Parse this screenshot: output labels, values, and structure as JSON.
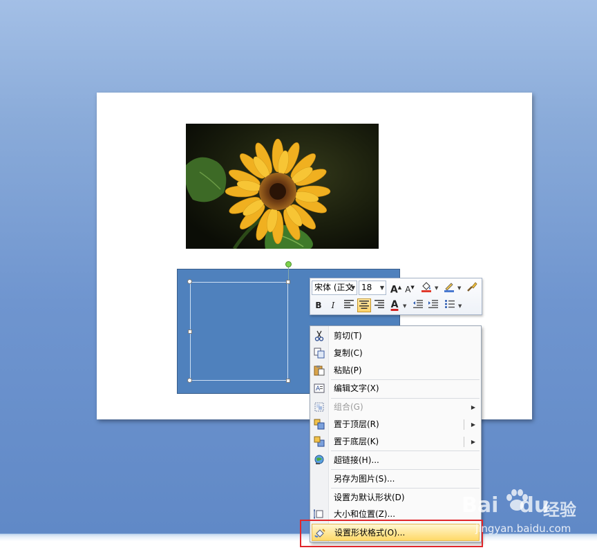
{
  "mini_toolbar": {
    "font_name": "宋体 (正文",
    "font_size": "18",
    "grow_font_icon": "A",
    "shrink_font_icon": "A",
    "bold": "B",
    "italic": "I",
    "font_color_icon": "A"
  },
  "context_menu": {
    "items": [
      {
        "label": "剪切(T)",
        "icon": "scissors-icon",
        "enabled": true
      },
      {
        "label": "复制(C)",
        "icon": "copy-icon",
        "enabled": true
      },
      {
        "label": "粘贴(P)",
        "icon": "paste-icon",
        "enabled": true
      },
      {
        "label": "编辑文字(X)",
        "icon": "edit-text-icon",
        "enabled": true
      },
      {
        "label": "组合(G)",
        "icon": "group-icon",
        "enabled": false,
        "submenu": true
      },
      {
        "label": "置于顶层(R)",
        "icon": "bring-to-front-icon",
        "enabled": true,
        "submenu": true
      },
      {
        "label": "置于底层(K)",
        "icon": "send-to-back-icon",
        "enabled": true,
        "submenu": true
      },
      {
        "label": "超链接(H)...",
        "icon": "hyperlink-icon",
        "enabled": true
      },
      {
        "label": "另存为图片(S)...",
        "icon": "",
        "enabled": true
      },
      {
        "label": "设置为默认形状(D)",
        "icon": "",
        "enabled": true
      },
      {
        "label": "大小和位置(Z)...",
        "icon": "size-position-icon",
        "enabled": true
      },
      {
        "label": "设置形状格式(O)...",
        "icon": "format-shape-icon",
        "enabled": true,
        "highlighted": true
      }
    ]
  },
  "watermark": {
    "brand": "Bai",
    "brand_suffix": "du",
    "product": "经验",
    "url": "jingyan.baidu.com"
  },
  "colors": {
    "shape_fill": "#4f81bd",
    "highlight": "#ffd968",
    "annotation_box": "#e0262a"
  }
}
